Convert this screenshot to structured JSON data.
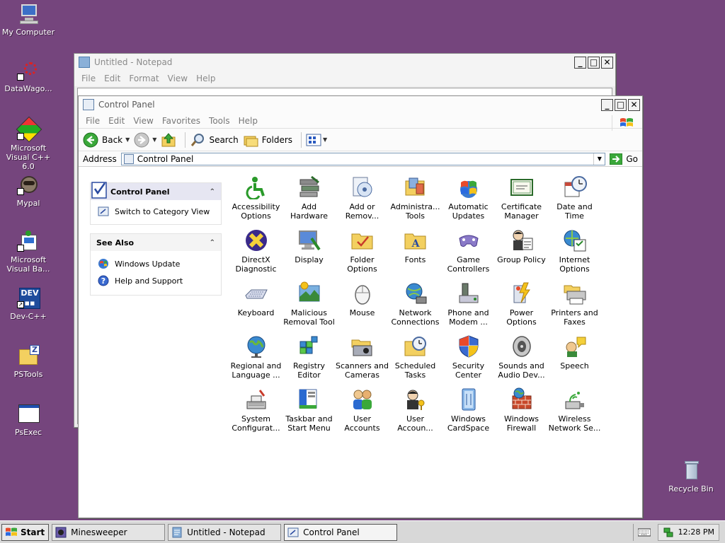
{
  "desktop": {
    "background": "#75457d",
    "icons": [
      {
        "label": "My Computer",
        "icon": "computer-icon"
      },
      {
        "label": "DataWago...",
        "icon": "datawago-icon"
      },
      {
        "label": "Microsoft Visual C++ 6.0",
        "icon": "visual-cpp-icon"
      },
      {
        "label": "Mypal",
        "icon": "mypal-icon"
      },
      {
        "label": "Microsoft Visual Ba...",
        "icon": "visual-basic-icon"
      },
      {
        "label": "Dev-C++",
        "icon": "devcpp-icon"
      },
      {
        "label": "PSTools",
        "icon": "folder-zip-icon"
      },
      {
        "label": "PsExec",
        "icon": "window-app-icon"
      }
    ],
    "recycle_bin": {
      "label": "Recycle Bin",
      "icon": "recycle-bin-icon"
    }
  },
  "notepad": {
    "title": "Untitled - Notepad",
    "menu": [
      "File",
      "Edit",
      "Format",
      "View",
      "Help"
    ]
  },
  "control_panel": {
    "title": "Control Panel",
    "menu": [
      "File",
      "Edit",
      "View",
      "Favorites",
      "Tools",
      "Help"
    ],
    "toolbar": {
      "back": "Back",
      "search": "Search",
      "folders": "Folders"
    },
    "address": {
      "label": "Address",
      "value": "Control Panel",
      "go": "Go"
    },
    "task_pane": {
      "control_panel_header": "Control Panel",
      "switch_view": "Switch to Category View",
      "see_also_header": "See Also",
      "see_also": [
        "Windows Update",
        "Help and Support"
      ]
    },
    "applets": [
      {
        "label": "Accessibility\nOptions",
        "icon": "accessibility-icon"
      },
      {
        "label": "Add\nHardware",
        "icon": "add-hardware-icon"
      },
      {
        "label": "Add or\nRemov...",
        "icon": "add-remove-icon"
      },
      {
        "label": "Administra...\nTools",
        "icon": "admin-tools-icon"
      },
      {
        "label": "Automatic\nUpdates",
        "icon": "automatic-updates-icon"
      },
      {
        "label": "Certificate\nManager",
        "icon": "certificate-icon"
      },
      {
        "label": "Date and\nTime",
        "icon": "date-time-icon"
      },
      {
        "label": "DirectX\nDiagnostic",
        "icon": "directx-icon"
      },
      {
        "label": "Display",
        "icon": "display-icon"
      },
      {
        "label": "Folder\nOptions",
        "icon": "folder-options-icon"
      },
      {
        "label": "Fonts",
        "icon": "fonts-icon"
      },
      {
        "label": "Game\nControllers",
        "icon": "game-controllers-icon"
      },
      {
        "label": "Group Policy",
        "icon": "group-policy-icon"
      },
      {
        "label": "Internet\nOptions",
        "icon": "internet-options-icon"
      },
      {
        "label": "Keyboard",
        "icon": "keyboard-icon"
      },
      {
        "label": "Malicious\nRemoval Tool",
        "icon": "malicious-removal-icon"
      },
      {
        "label": "Mouse",
        "icon": "mouse-icon"
      },
      {
        "label": "Network\nConnections",
        "icon": "network-icon"
      },
      {
        "label": "Phone and\nModem ...",
        "icon": "phone-modem-icon"
      },
      {
        "label": "Power\nOptions",
        "icon": "power-options-icon"
      },
      {
        "label": "Printers and\nFaxes",
        "icon": "printers-icon"
      },
      {
        "label": "Regional and\nLanguage ...",
        "icon": "regional-icon"
      },
      {
        "label": "Registry\nEditor",
        "icon": "registry-icon"
      },
      {
        "label": "Scanners and\nCameras",
        "icon": "scanners-icon"
      },
      {
        "label": "Scheduled\nTasks",
        "icon": "scheduled-tasks-icon"
      },
      {
        "label": "Security\nCenter",
        "icon": "security-center-icon"
      },
      {
        "label": "Sounds and\nAudio Dev...",
        "icon": "sounds-icon"
      },
      {
        "label": "Speech",
        "icon": "speech-icon"
      },
      {
        "label": "System\nConfigurat...",
        "icon": "system-config-icon"
      },
      {
        "label": "Taskbar and\nStart Menu",
        "icon": "taskbar-icon"
      },
      {
        "label": "User\nAccounts",
        "icon": "user-accounts-icon"
      },
      {
        "label": "User\nAccoun...",
        "icon": "user-accounts-2-icon"
      },
      {
        "label": "Windows\nCardSpace",
        "icon": "cardspace-icon"
      },
      {
        "label": "Windows\nFirewall",
        "icon": "firewall-icon"
      },
      {
        "label": "Wireless\nNetwork Se...",
        "icon": "wireless-icon"
      }
    ]
  },
  "taskbar": {
    "start": "Start",
    "tasks": [
      {
        "label": "Minesweeper",
        "active": false
      },
      {
        "label": "Untitled - Notepad",
        "active": false
      },
      {
        "label": "Control Panel",
        "active": true
      }
    ],
    "clock": "12:28 PM"
  }
}
